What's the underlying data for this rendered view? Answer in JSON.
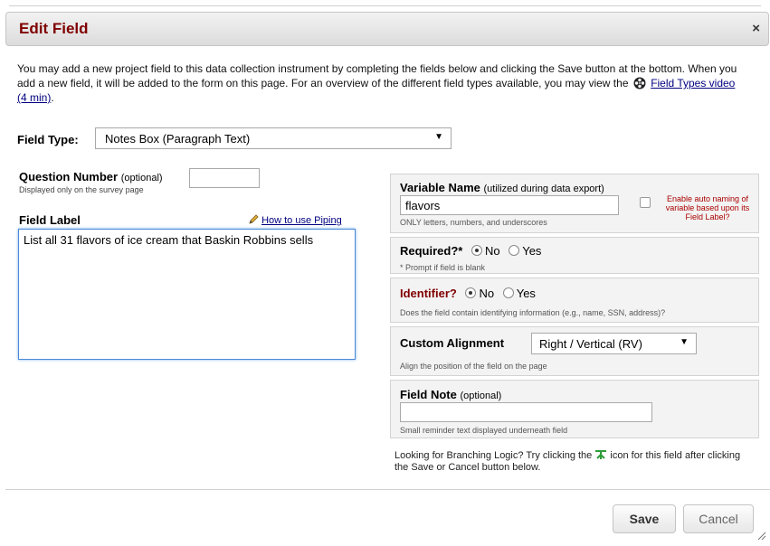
{
  "dialog": {
    "title": "Edit Field",
    "close_label": "×"
  },
  "intro": {
    "text_before": "You may add a new project field to this data collection instrument by completing the fields below and clicking the Save button at the bottom. When you add a new field, it will be added to the form on this page. For an overview of the different field types available, you may view the",
    "video_link": "Field Types video (4 min)",
    "text_after": "."
  },
  "field_type": {
    "label": "Field Type:",
    "selected": "Notes Box (Paragraph Text)"
  },
  "question_number": {
    "label": "Question Number",
    "optional": "(optional)",
    "sub": "Displayed only on the survey page",
    "value": ""
  },
  "field_label": {
    "label": "Field Label",
    "piping_link": "How to use Piping",
    "value": "List all 31 flavors of ice cream that Baskin Robbins sells"
  },
  "variable_name": {
    "label": "Variable Name",
    "note": "(utilized during data export)",
    "value": "flavors",
    "sub": "ONLY letters, numbers, and underscores",
    "auto_naming": "Enable auto naming of variable based upon its Field Label?"
  },
  "required": {
    "label": "Required?*",
    "options": [
      "No",
      "Yes"
    ],
    "selected": "No",
    "sub": "* Prompt if field is blank"
  },
  "identifier": {
    "label": "Identifier?",
    "options": [
      "No",
      "Yes"
    ],
    "selected": "No",
    "sub": "Does the field contain identifying information (e.g., name, SSN, address)?"
  },
  "alignment": {
    "label": "Custom Alignment",
    "selected": "Right / Vertical (RV)",
    "sub": "Align the position of the field on the page"
  },
  "field_note": {
    "label": "Field Note",
    "optional": "(optional)",
    "value": "",
    "sub": "Small reminder text displayed underneath field"
  },
  "branching": {
    "text_before": "Looking for Branching Logic? Try clicking the",
    "text_after": "icon for this field after clicking the Save or Cancel button below."
  },
  "buttons": {
    "save": "Save",
    "cancel": "Cancel"
  },
  "colors": {
    "title": "#800000",
    "link": "#000080",
    "auto_naming": "#aa0000"
  }
}
